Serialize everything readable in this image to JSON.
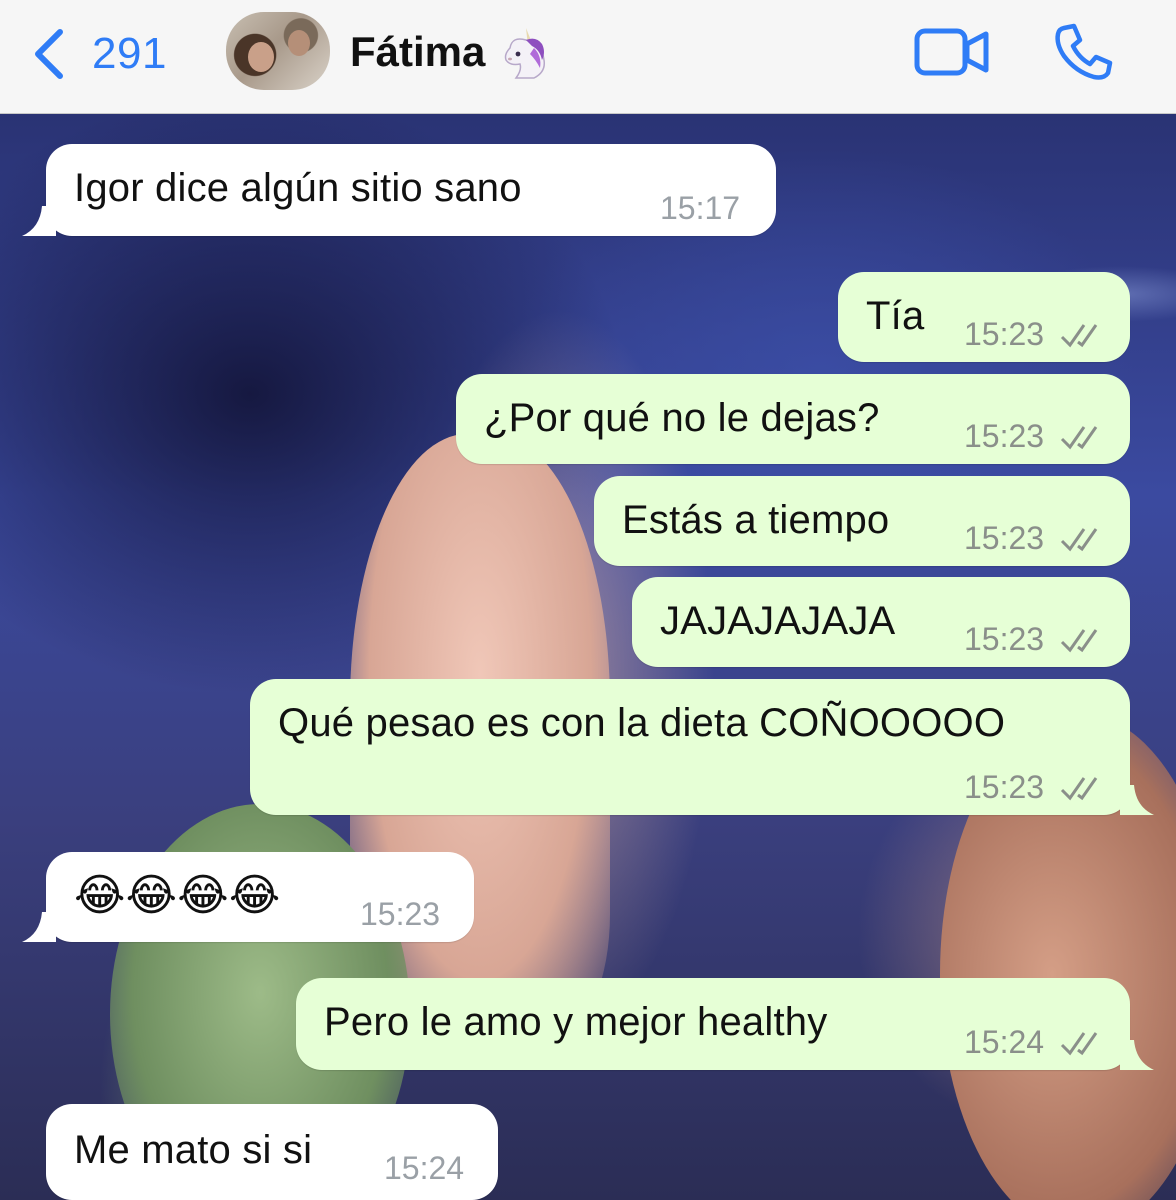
{
  "header": {
    "back_count": "291",
    "contact_name": "Fátima",
    "contact_emoji_icon": "unicorn-icon",
    "accent_color": "#2f7cf6"
  },
  "messages": [
    {
      "direction": "in",
      "text": "Igor dice algún sitio sano",
      "time": "15:17"
    },
    {
      "direction": "out",
      "text": "Tía",
      "time": "15:23",
      "status": "read"
    },
    {
      "direction": "out",
      "text": "¿Por qué no le dejas?",
      "time": "15:23",
      "status": "read"
    },
    {
      "direction": "out",
      "text": "Estás a tiempo",
      "time": "15:23",
      "status": "read"
    },
    {
      "direction": "out",
      "text": "JAJAJAJAJA",
      "time": "15:23",
      "status": "read"
    },
    {
      "direction": "out",
      "text": "Qué pesao es con la dieta COÑOOOOO",
      "time": "15:23",
      "status": "read"
    },
    {
      "direction": "in",
      "text": "😂😂😂😂",
      "time": "15:23"
    },
    {
      "direction": "out",
      "text": "Pero le amo y mejor healthy",
      "time": "15:24",
      "status": "read"
    },
    {
      "direction": "in",
      "text": "Me mato si si",
      "time": "15:24"
    }
  ],
  "colors": {
    "incoming_bubble": "#ffffff",
    "outgoing_bubble": "#e6ffd6",
    "header_background": "#f6f6f6"
  }
}
